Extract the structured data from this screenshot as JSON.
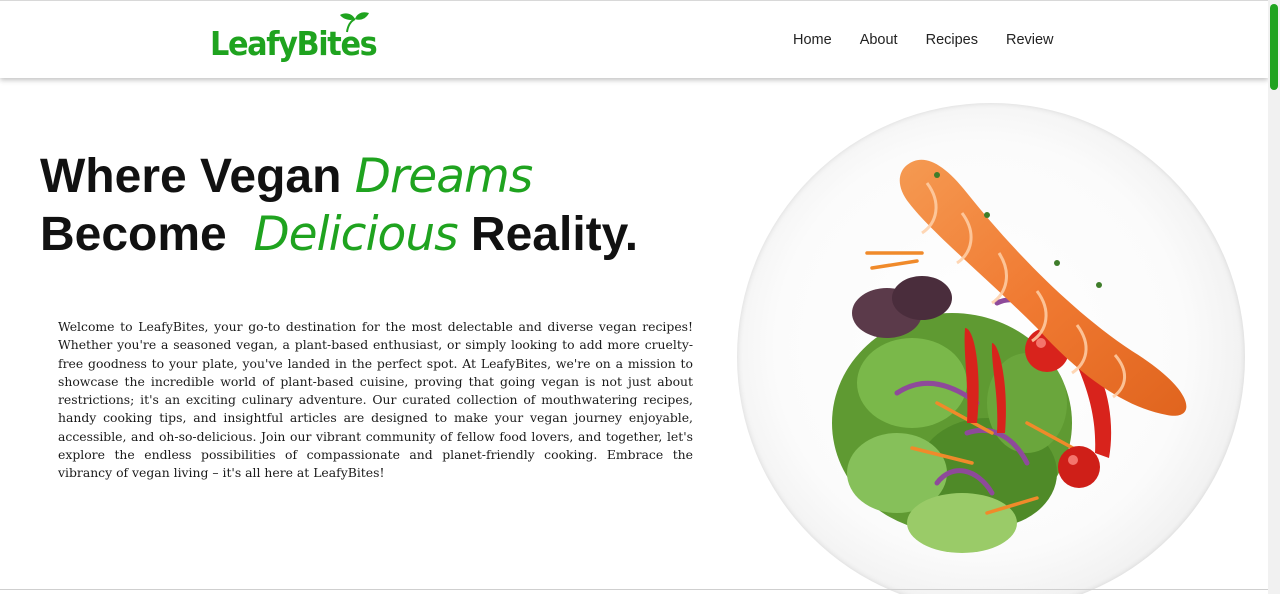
{
  "brand": {
    "name": "LeafyBites",
    "color": "#1fa31f"
  },
  "nav": {
    "items": [
      {
        "label": "Home"
      },
      {
        "label": "About"
      },
      {
        "label": "Recipes"
      },
      {
        "label": "Review"
      }
    ]
  },
  "hero": {
    "line1_prefix": "Where Vegan ",
    "line1_accent": "Dreams",
    "line2_prefix": "Become ",
    "line2_accent": "Delicious",
    "line2_suffix": " Reality.",
    "intro": "Welcome to LeafyBites, your go-to destination for the most delectable and diverse vegan recipes! Whether you're a seasoned vegan, a plant-based enthusiast, or simply looking to add more cruelty-free goodness to your plate, you've landed in the perfect spot. At LeafyBites, we're on a mission to showcase the incredible world of plant-based cuisine, proving that going vegan is not just about restrictions; it's an exciting culinary adventure. Our curated collection of mouthwatering recipes, handy cooking tips, and insightful articles are designed to make your vegan journey enjoyable, accessible, and oh-so-delicious. Join our vibrant community of fellow food lovers, and together, let's explore the endless possibilities of compassionate and planet-friendly cooking. Embrace the vibrancy of vegan living – it's all here at LeafyBites!"
  },
  "image": {
    "semantic": "salmon-salad-plate-image"
  },
  "scrollbar": {
    "thumb_color": "#1fa31f"
  }
}
